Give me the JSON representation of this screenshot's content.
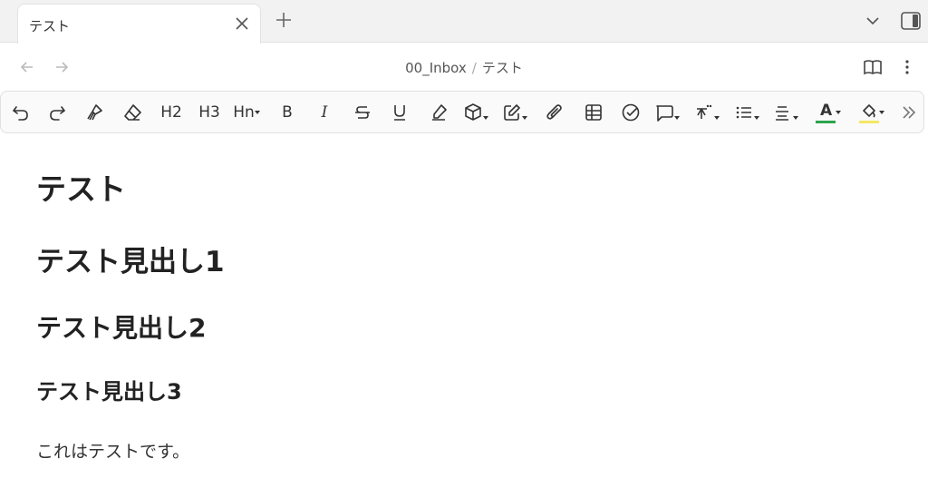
{
  "tab": {
    "title": "テスト"
  },
  "breadcrumb": {
    "folder": "00_Inbox",
    "separator": "/",
    "note": "テスト"
  },
  "toolbar": {
    "h2": "H2",
    "h3": "H3",
    "hn": "Hn",
    "bold": "B",
    "italic": "I",
    "text_color_label": "A",
    "text_color": "#2da44e",
    "highlight_color": "#f5e663"
  },
  "document": {
    "title": "テスト",
    "heading1": "テスト見出し1",
    "heading2": "テスト見出し2",
    "heading3": "テスト見出し3",
    "paragraph": "これはテストです。"
  }
}
